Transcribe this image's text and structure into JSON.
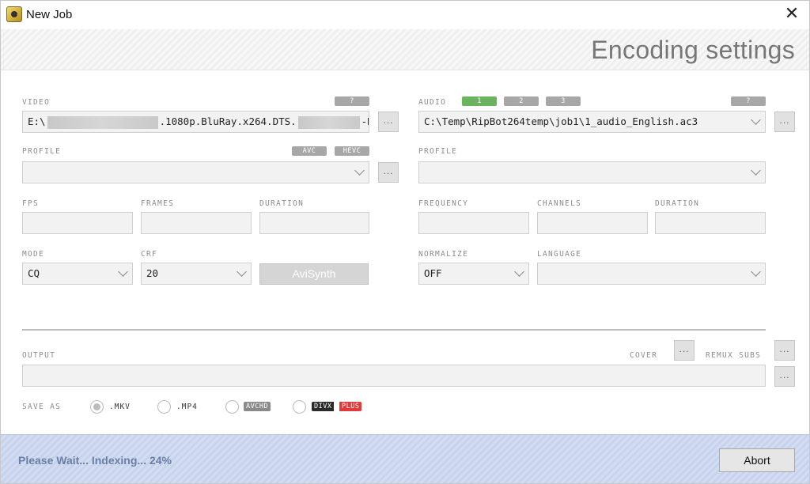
{
  "window": {
    "title": "New Job"
  },
  "header": {
    "title": "Encoding settings"
  },
  "video": {
    "label": "VIDEO",
    "help": "?",
    "path_prefix": "E:\\",
    "path_middle": ".1080p.BluRay.x264.DTS.",
    "path_suffix": "-D",
    "browse": "...",
    "profile_label": "PROFILE",
    "avc": "AVC",
    "hevc": "HEVC",
    "profile_value": "",
    "profile_browse": "...",
    "fps_label": "FPS",
    "frames_label": "FRAMES",
    "duration_label": "DURATION",
    "fps": "",
    "frames": "",
    "duration": "",
    "mode_label": "MODE",
    "mode": "CQ",
    "crf_label": "CRF",
    "crf": "20",
    "avisynth": "AviSynth"
  },
  "audio": {
    "label": "AUDIO",
    "tracks": [
      "1",
      "2",
      "3"
    ],
    "help": "?",
    "path": "C:\\Temp\\RipBot264temp\\job1\\1_audio_English.ac3",
    "browse": "...",
    "profile_label": "PROFILE",
    "profile_value": "",
    "frequency_label": "FREQUENCY",
    "channels_label": "CHANNELS",
    "duration_label": "DURATION",
    "frequency": "",
    "channels": "",
    "duration": "",
    "normalize_label": "NORMALIZE",
    "normalize": "OFF",
    "language_label": "LANGUAGE",
    "language": ""
  },
  "output": {
    "label": "OUTPUT",
    "cover_label": "COVER",
    "cover_btn": "...",
    "remux_label": "REMUX SUBS",
    "remux_btn": "...",
    "path": "",
    "browse": "...",
    "save_as_label": "SAVE AS",
    "formats": [
      ".MKV",
      ".MP4",
      "AVCHD"
    ],
    "divx": "DIVX",
    "divx_plus": "PLUS"
  },
  "status": {
    "text": "Please Wait... Indexing... 24%",
    "abort": "Abort"
  },
  "colors": {
    "accent_green": "#6bb35f",
    "status_text": "#6b7fa6",
    "divx_plus_red": "#e23a3a"
  }
}
